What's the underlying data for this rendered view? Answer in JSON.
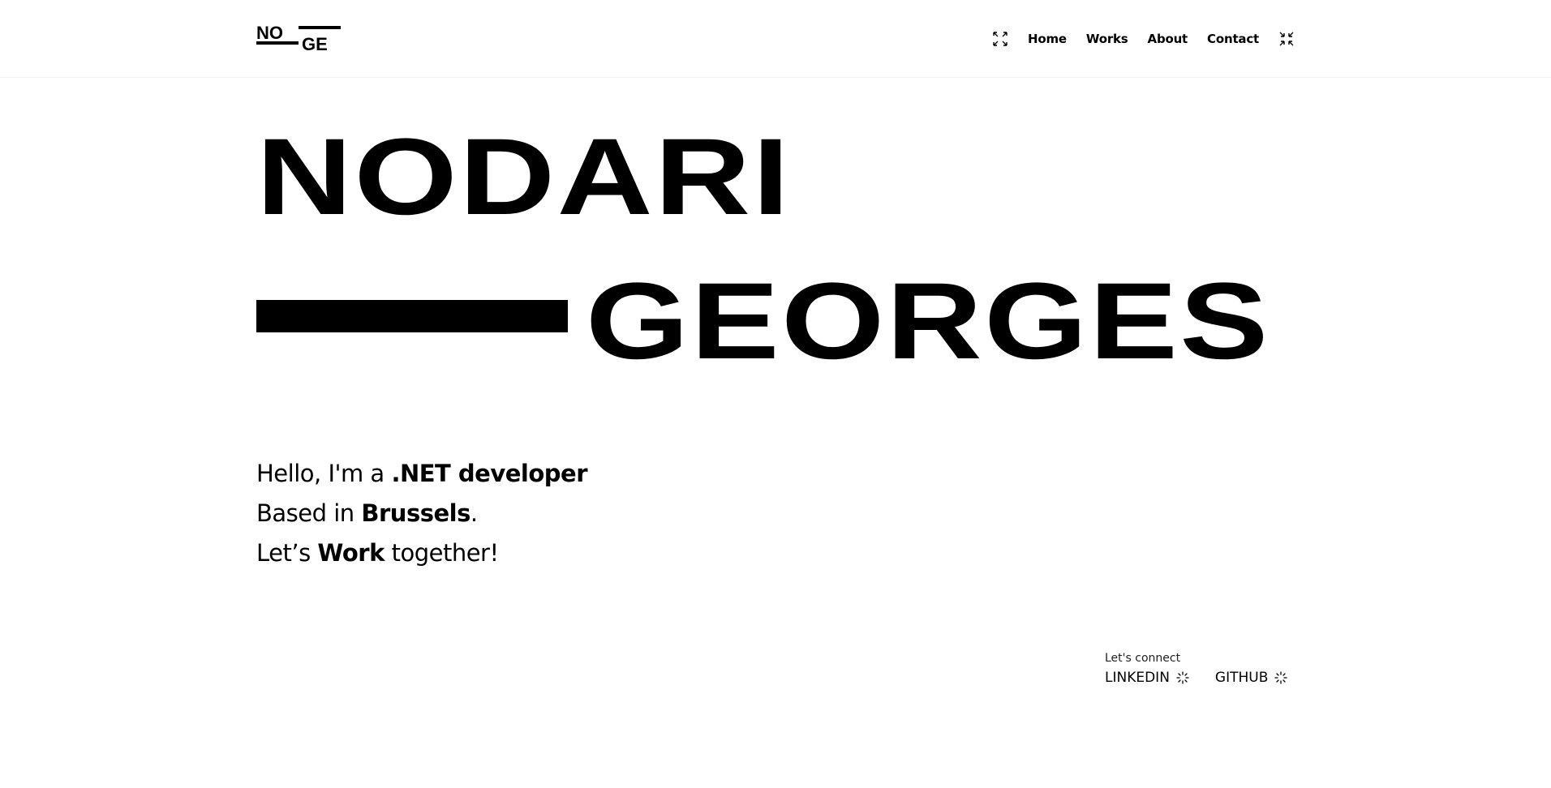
{
  "header": {
    "logo": {
      "top": "NO",
      "bottom": "GE"
    },
    "nav": {
      "items": [
        {
          "label": "Home"
        },
        {
          "label": "Works"
        },
        {
          "label": "About"
        },
        {
          "label": "Contact"
        }
      ],
      "left_icon": "expand-arrows-icon",
      "right_icon": "expand-arrows-icon"
    }
  },
  "hero": {
    "first_name": "NODARI",
    "last_name": "GEORGES"
  },
  "intro": {
    "line1_prefix": "Hello, I'm a ",
    "line1_bold": ".NET developer",
    "line2_prefix": "Based in ",
    "line2_bold": "Brussels",
    "line2_suffix": ".",
    "line3_prefix": "Let’s ",
    "line3_bold": "Work",
    "line3_suffix": " together!"
  },
  "connect": {
    "label": "Let's connect",
    "links": [
      {
        "label": "LINKEDIN",
        "icon": "sparkle-icon"
      },
      {
        "label": "GITHUB",
        "icon": "sparkle-icon"
      }
    ]
  },
  "colors": {
    "text": "#000000",
    "background": "#ffffff"
  }
}
